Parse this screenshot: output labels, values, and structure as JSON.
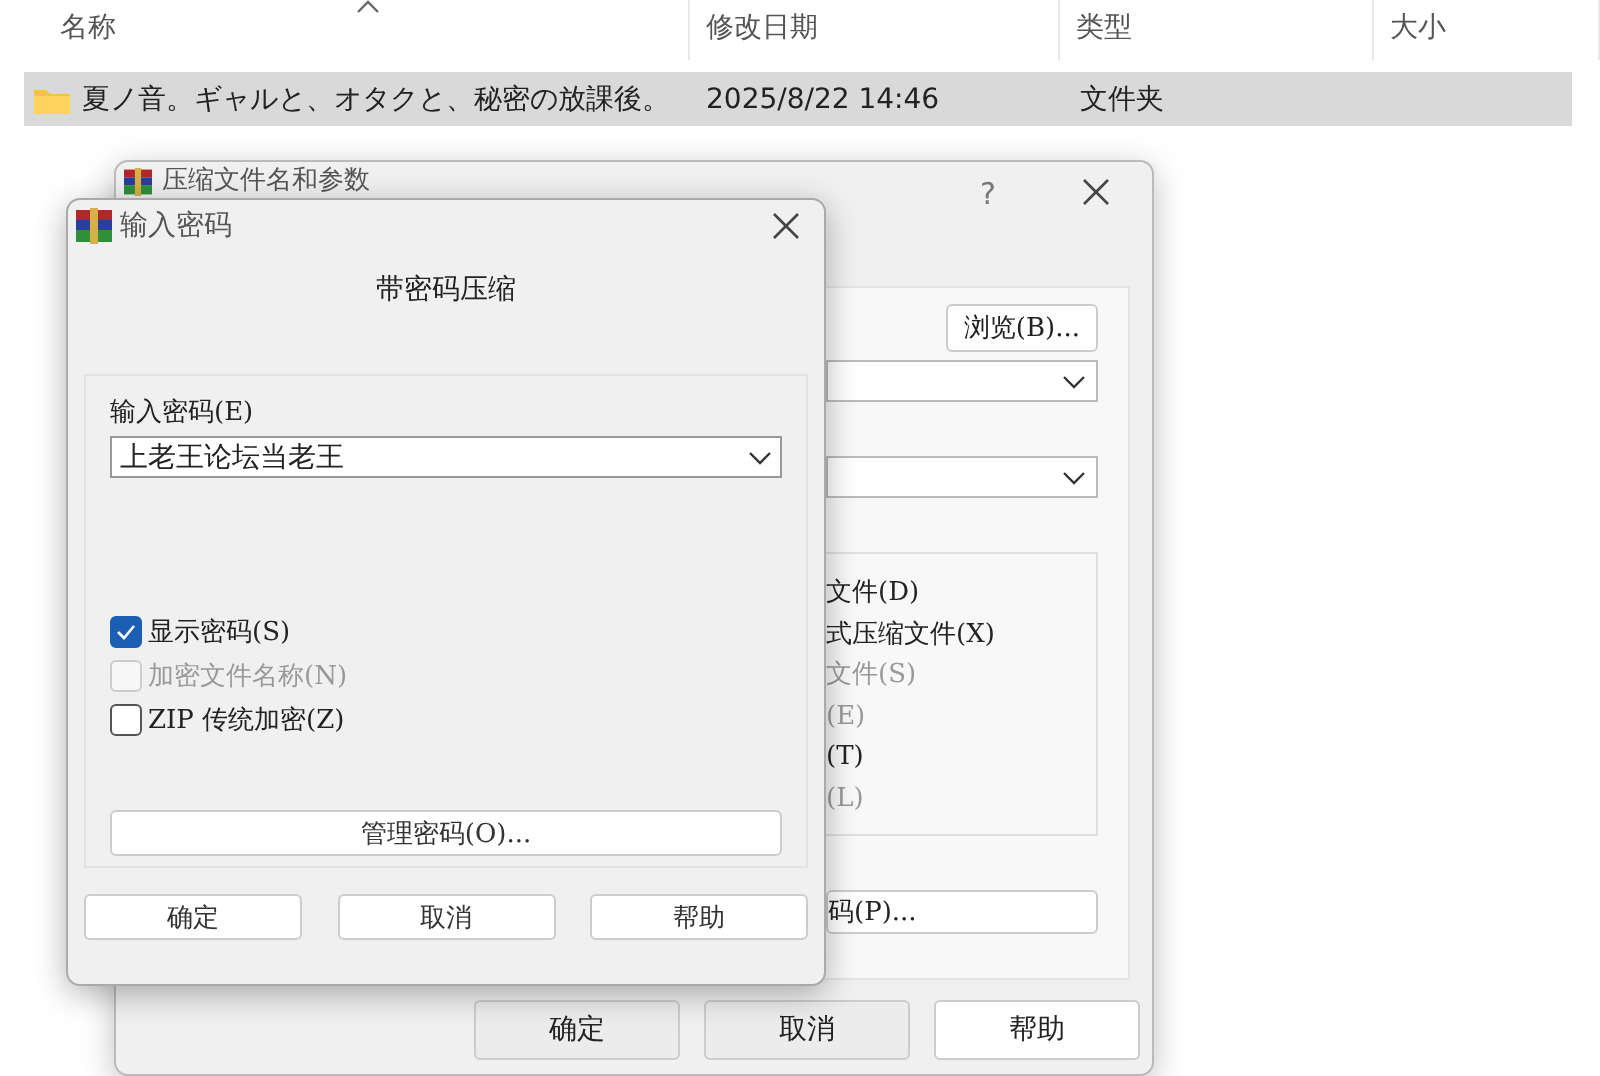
{
  "explorer": {
    "columns": [
      {
        "label": "名称"
      },
      {
        "label": "修改日期"
      },
      {
        "label": "类型"
      },
      {
        "label": "大小"
      }
    ],
    "rows": [
      {
        "name": "夏ノ音。ギャルと、オタクと、秘密の放課後。",
        "modified": "2025/8/22 14:46",
        "type": "文件夹",
        "selected": true
      }
    ]
  },
  "archive_dialog": {
    "title": "压缩文件名和参数",
    "help_glyph": "?",
    "browse_button": "浏览(B)...",
    "options": [
      {
        "label": "文件(D)",
        "disabled": false
      },
      {
        "label": "式压缩文件(X)",
        "disabled": false
      },
      {
        "label": "文件(S)",
        "disabled": true
      },
      {
        "label": "(E)",
        "disabled": true
      },
      {
        "label": "(T)",
        "disabled": false
      },
      {
        "label": "(L)",
        "disabled": true
      }
    ],
    "password_button": "码(P)...",
    "buttons": [
      {
        "label": "确定"
      },
      {
        "label": "取消"
      },
      {
        "label": "帮助"
      }
    ]
  },
  "password_dialog": {
    "title": "输入密码",
    "heading": "带密码压缩",
    "password_label": "输入密码(E)",
    "password_value": "上老王论坛当老王",
    "checkboxes": [
      {
        "label": "显示密码(S)",
        "checked": true,
        "disabled": false
      },
      {
        "label": "加密文件名称(N)",
        "checked": false,
        "disabled": true
      },
      {
        "label": "ZIP 传统加密(Z)",
        "checked": false,
        "disabled": false
      }
    ],
    "manage_button": "管理密码(O)...",
    "buttons": [
      {
        "label": "确定"
      },
      {
        "label": "取消"
      },
      {
        "label": "帮助"
      }
    ]
  }
}
